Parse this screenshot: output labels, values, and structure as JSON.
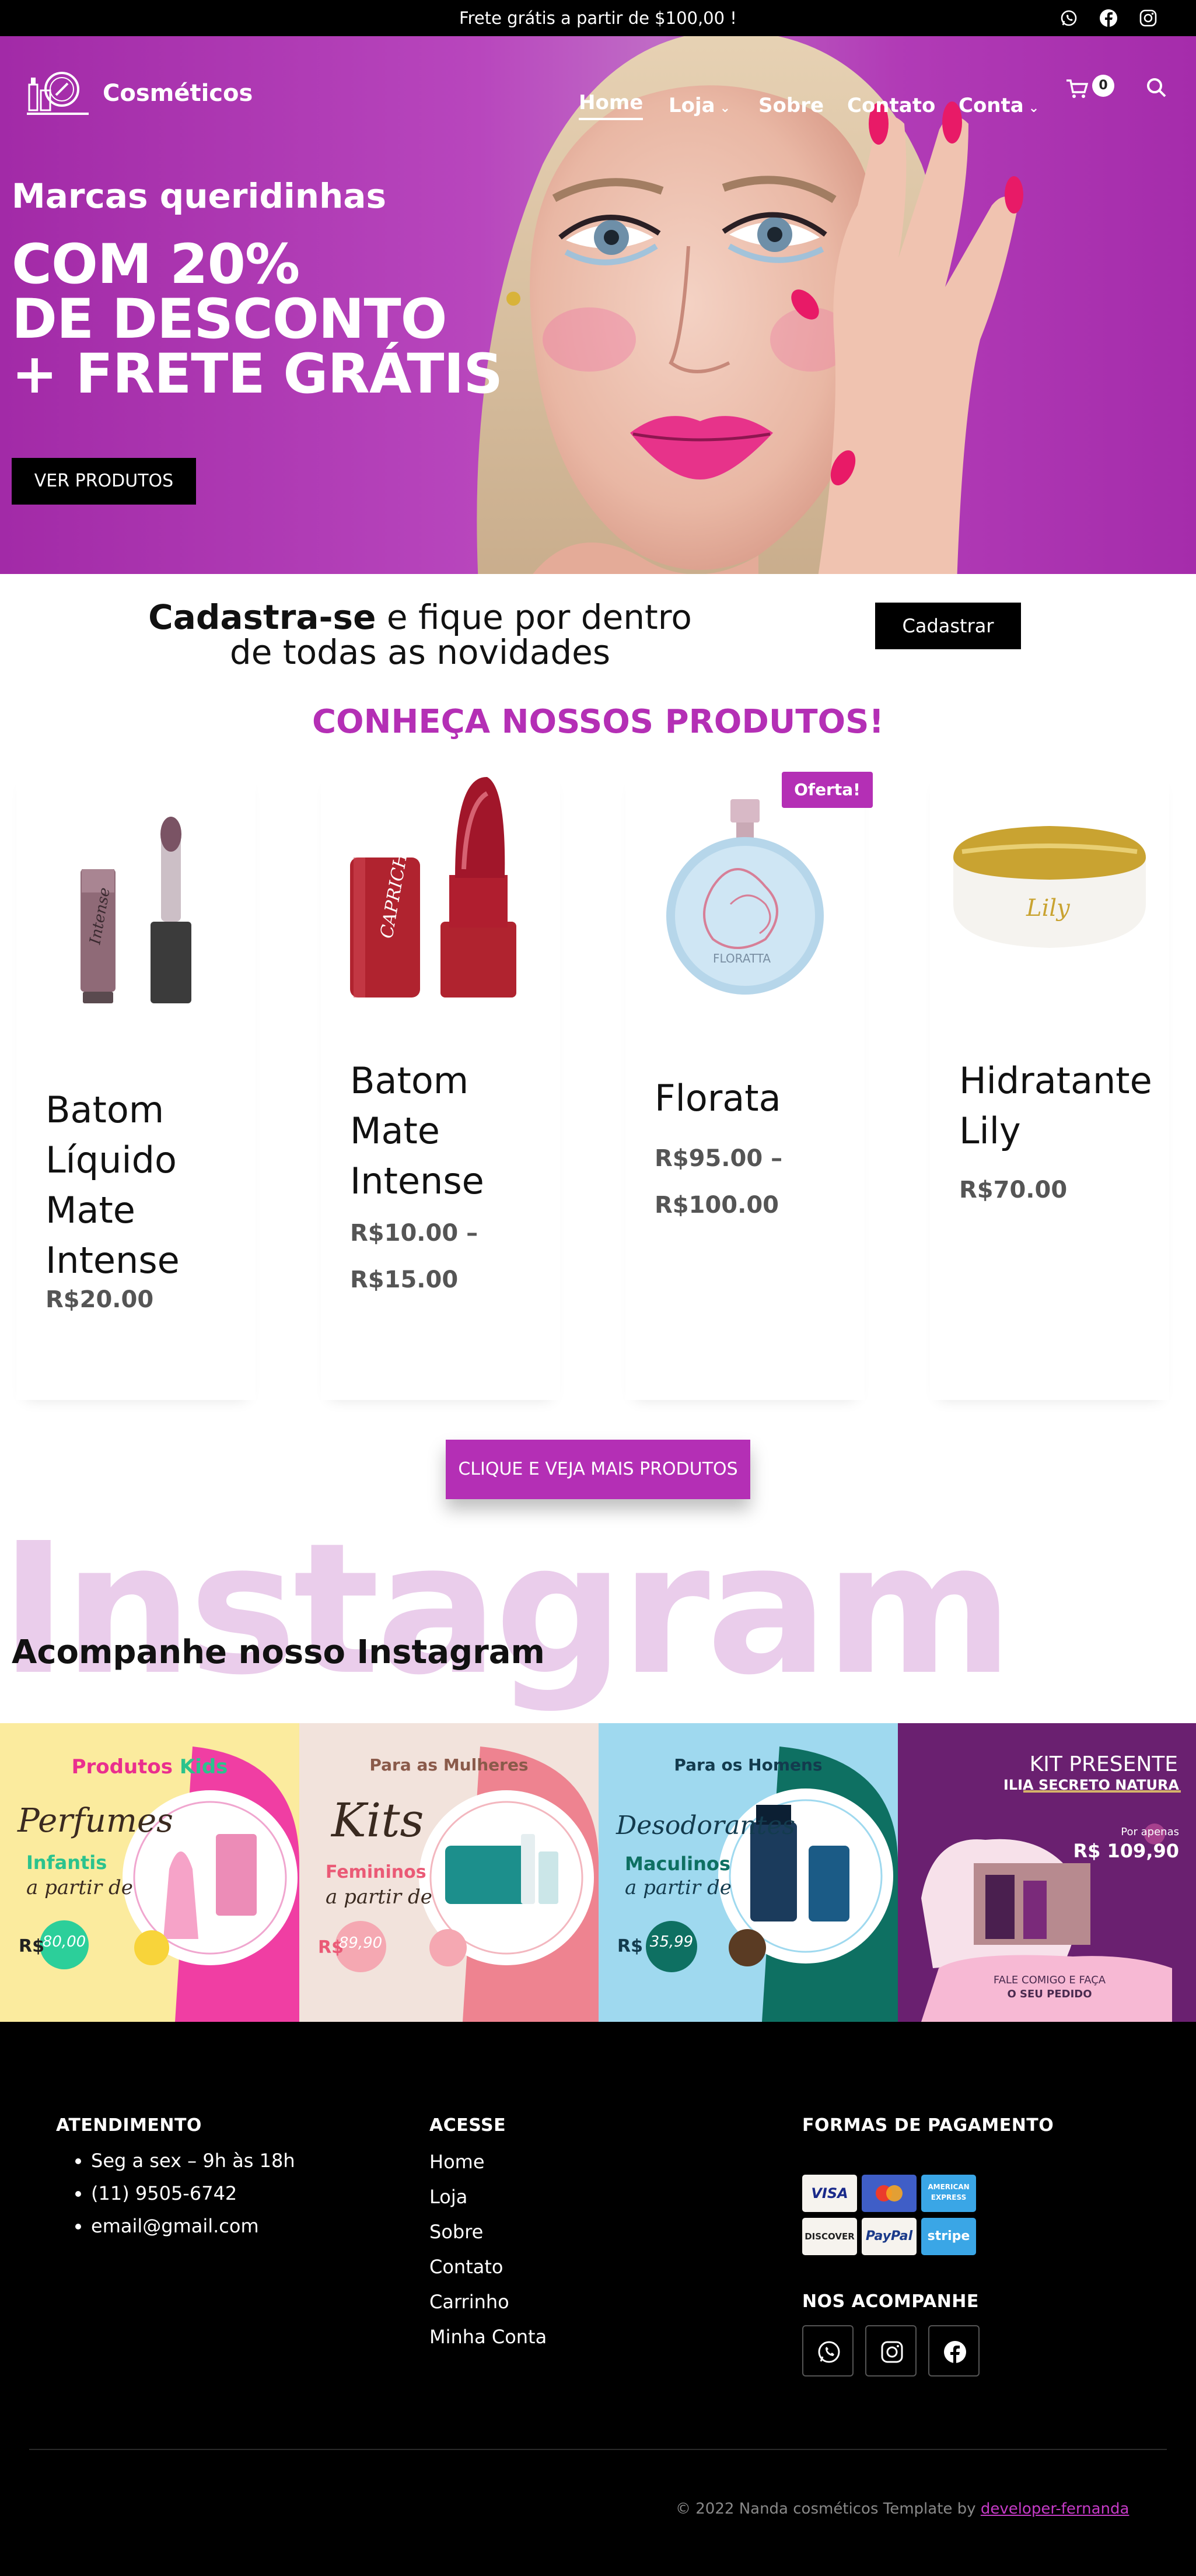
{
  "topbar": {
    "message": "Frete grátis a partir de $100,00 !",
    "social_icons": [
      "whatsapp-icon",
      "facebook-icon",
      "instagram-icon"
    ]
  },
  "header": {
    "brand": "Cosméticos",
    "nav": [
      {
        "label": "Home",
        "active": true
      },
      {
        "label": "Loja",
        "dropdown": true
      },
      {
        "label": "Sobre"
      },
      {
        "label": "Contato"
      },
      {
        "label": "Conta",
        "dropdown": true
      }
    ],
    "cart_count": "0"
  },
  "hero": {
    "subtitle": "Marcas queridinhas",
    "title_lines": [
      "COM 20%",
      "DE DESCONTO",
      "+ FRETE GRÁTIS"
    ],
    "cta": "VER PRODUTOS"
  },
  "newsletter": {
    "bold": "Cadastra-se",
    "text_rest": " e fique por dentro",
    "line2": "de todas as novidades",
    "button": "Cadastrar"
  },
  "products": {
    "heading": "CONHEÇA NOSSOS PRODUTOS!",
    "sale_badge": "Oferta!",
    "items": [
      {
        "title_lines": [
          "Batom",
          "Líquido",
          "Mate",
          "Intense"
        ],
        "price_lines": [
          "R$20.00"
        ]
      },
      {
        "title_lines": [
          "Batom",
          "Mate",
          "Intense"
        ],
        "price_lines": [
          "R$10.00 –",
          "R$15.00"
        ]
      },
      {
        "title_lines": [
          "Florata"
        ],
        "price_lines": [
          "R$95.00 –",
          "R$100.00"
        ]
      },
      {
        "title_lines": [
          "Hidratante",
          "Lily"
        ],
        "price_lines": [
          "R$70.00"
        ]
      }
    ],
    "more_button": "CLIQUE E VEJA MAIS PRODUTOS",
    "image_labels": [
      "Intense",
      "CAPRICHO",
      "FLORATTA",
      "Lily"
    ]
  },
  "instagram": {
    "big_word": "Instagram",
    "heading": "Acompanhe nosso Instagram",
    "tiles": [
      {
        "top": "Produtos",
        "top2": "Kids",
        "script": "Perfumes",
        "accent": "Infantis",
        "script2": "a partir de",
        "currency": "R$",
        "price": "80,00"
      },
      {
        "top": "Para as Mulheres",
        "script": "Kits",
        "accent": "Femininos",
        "script2": "a partir de",
        "currency": "R$",
        "price": "89,90"
      },
      {
        "top": "Para os Homens",
        "script": "Desodorantes",
        "accent": "Maculinos",
        "script2": "a partir de",
        "currency": "R$",
        "price": "35,99"
      },
      {
        "top": "KIT PRESENTE",
        "top2": "ILIA SECRETO NATURA",
        "small": "Por apenas",
        "price": "R$ 109,90",
        "bottom1": "FALE COMIGO E FAÇA",
        "bottom2": "O SEU PEDIDO"
      }
    ]
  },
  "footer": {
    "atendimento": {
      "title": "ATENDIMENTO",
      "items": [
        "Seg a sex – 9h às 18h",
        "(11) 9505-6742",
        "email@gmail.com"
      ]
    },
    "acesse": {
      "title": "ACESSE",
      "links": [
        "Home",
        "Loja",
        "Sobre",
        "Contato",
        "Carrinho",
        "Minha Conta"
      ]
    },
    "pagamento": {
      "title": "FORMAS DE PAGAMENTO",
      "methods": [
        "VISA",
        "mastercard",
        "AMERICAN EXPRESS",
        "DISCOVER",
        "PayPal",
        "stripe"
      ]
    },
    "social": {
      "title": "NOS ACOMPANHE",
      "icons": [
        "whatsapp-icon",
        "instagram-icon",
        "facebook-icon"
      ]
    },
    "copyright": "© 2022 Nanda cosméticos Template by ",
    "copyright_link": "developer-fernanda"
  }
}
